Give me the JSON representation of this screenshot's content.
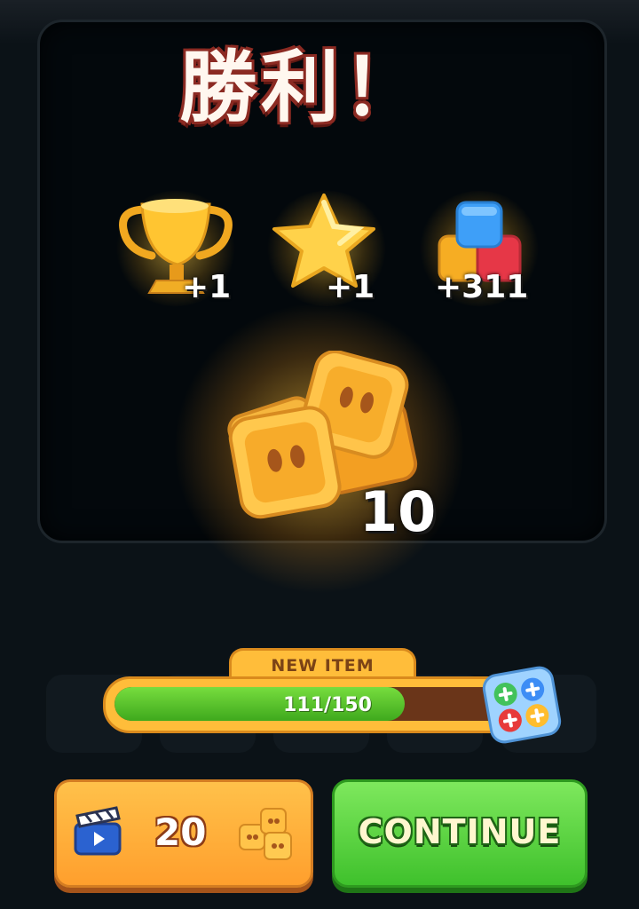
{
  "title": "勝利！",
  "rewards": [
    {
      "icon": "trophy-icon",
      "amount": "+1"
    },
    {
      "icon": "star-icon",
      "amount": "+1"
    },
    {
      "icon": "cubes-icon",
      "amount": "+311"
    }
  ],
  "main_reward": {
    "icon": "button-coins-icon",
    "amount": "10"
  },
  "progress": {
    "label": "NEW ITEM",
    "value_text": "111/150",
    "current": 111,
    "max": 150,
    "item_icon": "screw-tray-icon"
  },
  "buttons": {
    "ad_reward_amount": "20",
    "ad_icon": "clapperboard-icon",
    "ad_reward_icon": "button-coins-icon",
    "continue_label": "CONTINUE"
  },
  "colors": {
    "progress_fill": "#4fbf2a",
    "continue_button": "#55cf35",
    "ad_button": "#ffb13b",
    "title_outline": "#8b2a22"
  }
}
